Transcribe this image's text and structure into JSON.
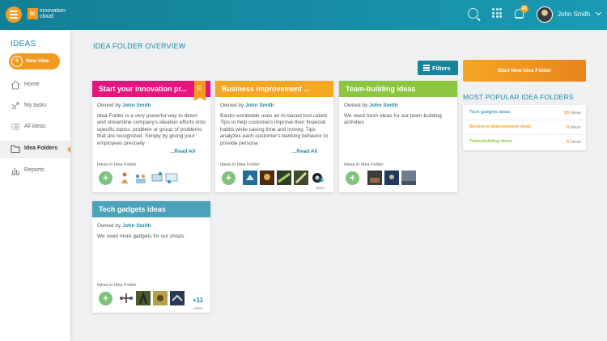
{
  "header": {
    "logo_mark": "ic",
    "logo_line1": "innovation",
    "logo_line2": "cloud",
    "notifications_count": "41",
    "user_name": "John Smith"
  },
  "sidebar": {
    "title": "IDEAS",
    "new_idea_label": "New idea",
    "items": [
      {
        "label": "Home",
        "icon": "home-icon"
      },
      {
        "label": "My tasks",
        "icon": "tasks-icon"
      },
      {
        "label": "All ideas",
        "icon": "list-icon"
      },
      {
        "label": "Idea Folders",
        "icon": "folder-icon",
        "active": true
      },
      {
        "label": "Reports",
        "icon": "bar-chart-icon"
      }
    ]
  },
  "main": {
    "title": "IDEA FOLDER OVERVIEW",
    "filters_label": "Filters",
    "start_label": "Start New Idea Folder"
  },
  "folders": [
    {
      "title": "Start your innovation pr...",
      "color": "#e5157f",
      "owned_prefix": "Owned by ",
      "owner": "John Smith",
      "description": "Idea Folder is a very powerful way to direct and streamline company's ideation efforts onto specific topics, problem or group of problems that are recognized. Simply by giving your employees precisely ",
      "read_all": "...Read All",
      "ideas_label": "Ideas in Idea Folder",
      "more_count": "",
      "more_text": ""
    },
    {
      "title": "Business improvement ...",
      "color": "#f5a623",
      "owned_prefix": "Owned by ",
      "owner": "John Smith",
      "description": "Banks worldwide uses an AI-based tool called Tips to help customers improve their financial habits while saving time and money. Tips analyzes each customer's banking behavior to provide persona",
      "read_all": "...Read All",
      "ideas_label": "Ideas in Idea Folder",
      "more_count": "+5",
      "more_text": "ideas"
    },
    {
      "title": "Team-building ideas",
      "color": "#8cc63f",
      "owned_prefix": "Owned by ",
      "owner": "John Smith",
      "description": "We need fresh ideas for our team-building activities",
      "read_all": "",
      "ideas_label": "Ideas in Idea Folder",
      "more_count": "",
      "more_text": ""
    },
    {
      "title": "Tech gadgets ideas",
      "color": "#4aa3ba",
      "owned_prefix": "Owned by ",
      "owner": "John Smith",
      "description": "We need more gadgets for our shops.",
      "read_all": "",
      "ideas_label": "Ideas in Idea Folder",
      "more_count": "+11",
      "more_text": "ideas"
    }
  ],
  "popular": {
    "title": "MOST POPULAR IDEA FOLDERS",
    "items": [
      {
        "name": "Tech gadgets ideas",
        "count": "15",
        "unit": " Ideas",
        "color": "#4aa3ba"
      },
      {
        "name": "Business improvement ideas",
        "count": "9",
        "unit": " Ideas",
        "color": "#f5a623"
      },
      {
        "name": "Team-building ideas",
        "count": "3",
        "unit": " Ideas",
        "color": "#8cc63f"
      }
    ]
  },
  "colors": {
    "header": "#1a8aa3",
    "accent": "#f39a1f",
    "add_button": "#7cc37c"
  }
}
